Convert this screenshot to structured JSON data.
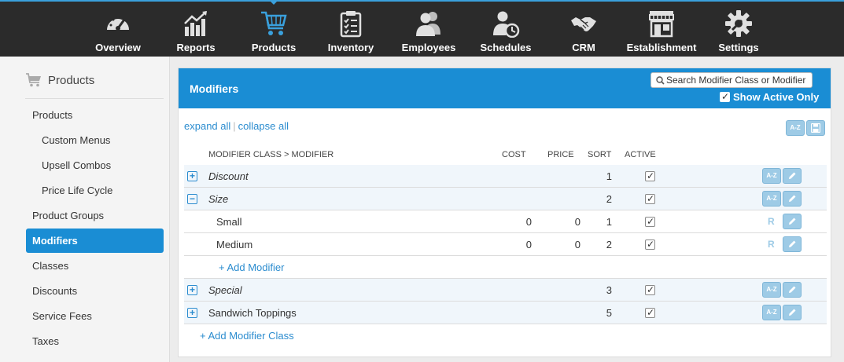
{
  "nav": {
    "items": [
      {
        "label": "Overview",
        "icon": "speedometer-icon"
      },
      {
        "label": "Reports",
        "icon": "bar-chart-icon"
      },
      {
        "label": "Products",
        "icon": "shopping-cart-icon",
        "active": true
      },
      {
        "label": "Inventory",
        "icon": "clipboard-icon"
      },
      {
        "label": "Employees",
        "icon": "people-icon"
      },
      {
        "label": "Schedules",
        "icon": "person-clock-icon"
      },
      {
        "label": "CRM",
        "icon": "handshake-icon"
      },
      {
        "label": "Establishment",
        "icon": "storefront-icon"
      },
      {
        "label": "Settings",
        "icon": "gear-icon"
      }
    ]
  },
  "sidebar": {
    "header": "Products",
    "items": [
      {
        "label": "Products"
      },
      {
        "label": "Custom Menus"
      },
      {
        "label": "Upsell Combos"
      },
      {
        "label": "Price Life Cycle"
      },
      {
        "label": "Product Groups"
      },
      {
        "label": "Modifiers",
        "active": true
      },
      {
        "label": "Classes"
      },
      {
        "label": "Discounts"
      },
      {
        "label": "Service Fees"
      },
      {
        "label": "Taxes"
      }
    ]
  },
  "panel": {
    "title": "Modifiers",
    "search_placeholder": "Search Modifier Class or Modifier",
    "show_active_label": "Show Active Only",
    "expand_all": "expand all",
    "collapse_all": "collapse all",
    "sort_az_label": "A-Z",
    "columns": {
      "name": "MODIFIER CLASS > MODIFIER",
      "cost": "COST",
      "price": "PRICE",
      "sort": "SORT",
      "active": "ACTIVE"
    },
    "rows": [
      {
        "type": "class",
        "name": "Discount",
        "italic": true,
        "expanded": false,
        "sort": "1",
        "active": true
      },
      {
        "type": "class",
        "name": "Size",
        "italic": true,
        "expanded": true,
        "sort": "2",
        "active": true
      },
      {
        "type": "modifier",
        "name": "Small",
        "cost": "0",
        "price": "0",
        "sort": "1",
        "active": true
      },
      {
        "type": "modifier",
        "name": "Medium",
        "cost": "0",
        "price": "0",
        "sort": "2",
        "active": true
      },
      {
        "type": "add-modifier",
        "label": "+ Add Modifier"
      },
      {
        "type": "class",
        "name": "Special",
        "italic": true,
        "expanded": false,
        "sort": "3",
        "active": true
      },
      {
        "type": "class",
        "name": "Sandwich Toppings",
        "italic": false,
        "expanded": false,
        "sort": "5",
        "active": true
      }
    ],
    "add_class_label": "+ Add Modifier Class",
    "r_badge": "R",
    "colors": {
      "accent": "#1a8dd4",
      "nav_bg": "#2b2b2b",
      "link": "#2b8ccf"
    }
  }
}
